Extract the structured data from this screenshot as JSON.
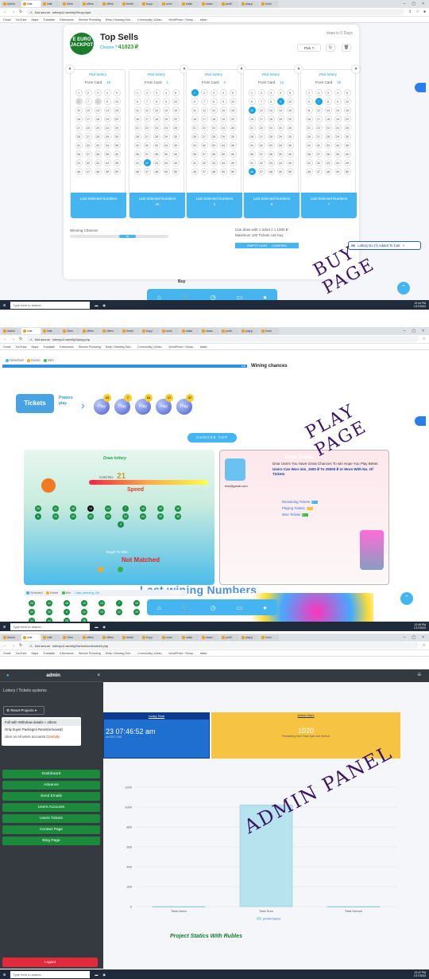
{
  "browser": {
    "tabs": [
      "Admin",
      "lotte",
      "lotte",
      "Clien",
      "offers",
      "offers",
      "freebi",
      "buy.p",
      "sumi",
      "static",
      "sharo",
      "profil",
      "play.p",
      "homi"
    ],
    "tabs_admin": [
      "Admin",
      "lotte",
      "lotte",
      "Clien",
      "offers",
      "offers",
      "freebi",
      "buy.p",
      "sumi",
      "static",
      "sharo",
      "profil",
      "play.p",
      "homi"
    ],
    "not_secure": "Not secure",
    "urls": [
      "lotteryv2.weebly2/buy.php#",
      "lotteryv2.weebly2/play.php",
      "lotteryv2.weebly2/admin/unit/unbeli.php"
    ],
    "bookmarks": [
      "Gmail",
      "YouTube",
      "Maps",
      "Translate",
      "Extensions",
      "Service Providing",
      "Deep Cleaning Dub...",
      "Community | A1fan...",
      "WordPress › Setup...",
      "estan"
    ]
  },
  "taskbar": {
    "search_placeholder": "Type here to search",
    "clocks": [
      {
        "time": "12:44 PM",
        "date": "1/17/2023"
      },
      {
        "time": "12:49 PM",
        "date": "1/17/2023"
      },
      {
        "time": "12:47 PM",
        "date": "1/17/2023"
      }
    ]
  },
  "buy": {
    "logo": "E EURO JACKPOT",
    "title": "Top Sells",
    "choose_label": "Choose ?",
    "choose_value": "41023",
    "currency": "₽",
    "draw_in": "draw in 0 Days",
    "pick_btn": "Pick ?",
    "tickets": [
      {
        "from": "10",
        "last": "",
        "sel": [],
        "dim": [
          6,
          8
        ]
      },
      {
        "from": "1",
        "last": "42",
        "sel": [
          42
        ],
        "dim": []
      },
      {
        "from": "3",
        "last": "1",
        "sel": [
          1
        ],
        "dim": []
      },
      {
        "from": "12",
        "last": "6",
        "sel": [
          9,
          11,
          46
        ],
        "dim": []
      },
      {
        "from": "20",
        "last": "7",
        "sel": [
          7
        ],
        "dim": []
      }
    ],
    "pick_lottery": "Pick lottery",
    "from_card": "From Card",
    "last_selected": "Last Selected Numbers",
    "winning_chances": "Winning Chances",
    "chance_pct": "50",
    "can_draw": "Can draw with 1 ticket ≠ x 1000 ₽",
    "max_tickets": "Maximum 100 Tickets can buy",
    "empty_cart": "EMPTY CART",
    "confirm": "CONFIRM",
    "toast": "Lottery No (7) Added To Cart",
    "nav_label": "Buy",
    "stamp": "BUY PAGE"
  },
  "play": {
    "legend": [
      "Selected",
      "Home",
      "Win"
    ],
    "legend_colors": [
      "#44b5f0",
      "#f7a826",
      "#3cc04a"
    ],
    "wining_chances": "Wining chances",
    "bar_value": "100",
    "logo": "Tickets",
    "powers": "Powers",
    "play_word": "Play",
    "balls": [
      "10",
      "7",
      "31",
      "17",
      "37"
    ],
    "choose_top": "CHOOSE TOP",
    "draw_lottery": "Draw lottery",
    "card_no_label": "Card No:",
    "card_no": "21",
    "speed": "Speed",
    "numbers_row1": [
      "25",
      "41",
      "48",
      "10",
      "14",
      "7",
      "18",
      "39",
      "26"
    ],
    "numbers_row2": [
      "6",
      "10",
      "19",
      "42",
      "20",
      "34",
      "44",
      "35",
      "38"
    ],
    "numbers_row3": [
      "3"
    ],
    "target_label": "Target To Win:",
    "not_matched": "Not Matched",
    "draw_details": "Draw Details",
    "details_text1": "Dear Users You Have Great Chances To win Hope You Play Better.",
    "details_text2": "Users Can Won min_1500 ₽ To 25000 ₽ or More With No. Of Tickets",
    "email": "test@gmail.com",
    "remaining": "Remaining Tickets",
    "playing": "Playing Tickets",
    "won": "Won Tickets",
    "remaining_val": "0",
    "playing_val": "1",
    "won_val": "0",
    "last_numbers": "Last wining Numbers",
    "last_winning_no": "Last_winning_No",
    "home_label": "Home",
    "stamp": "PLAY PAGE"
  },
  "admin": {
    "user": "admin",
    "system": "Lottery / Tickets systems",
    "reset": "Reset Projects",
    "menu": [
      "Full with Withdraw details + others",
      "Only buyer Packeges Reset(removed)",
      "ction on All users accounts",
      "Carefully"
    ],
    "buttons": [
      "Dashboard",
      "Advance",
      "Send Emails",
      "Users Accounts",
      "Users Tickets",
      "Contact Page",
      "Blog Page"
    ],
    "logout": "Logout",
    "blue_label": "Lucky Time",
    "blue_time": "23 07:46:52 am",
    "blue_sub": "ns 00:17:154",
    "yellow_label": "Active Sites",
    "yellow_value": "1020",
    "yellow_sub": "Remaining from Total Spin and Sellout",
    "chart_title_bottom": "Project Statics With Rubles",
    "stamp": "ADMIN PANEL"
  },
  "chart_data": {
    "type": "bar",
    "categories": [
      "Total Users",
      "Total Sum",
      "Total Surnce"
    ],
    "values": [
      0,
      1020,
      0
    ],
    "ylim": [
      0,
      1200
    ],
    "yticks": [
      "0",
      "200",
      "400",
      "600",
      "800",
      "1000",
      "1200"
    ],
    "legend": "performance",
    "color": "#b7e3ef"
  }
}
